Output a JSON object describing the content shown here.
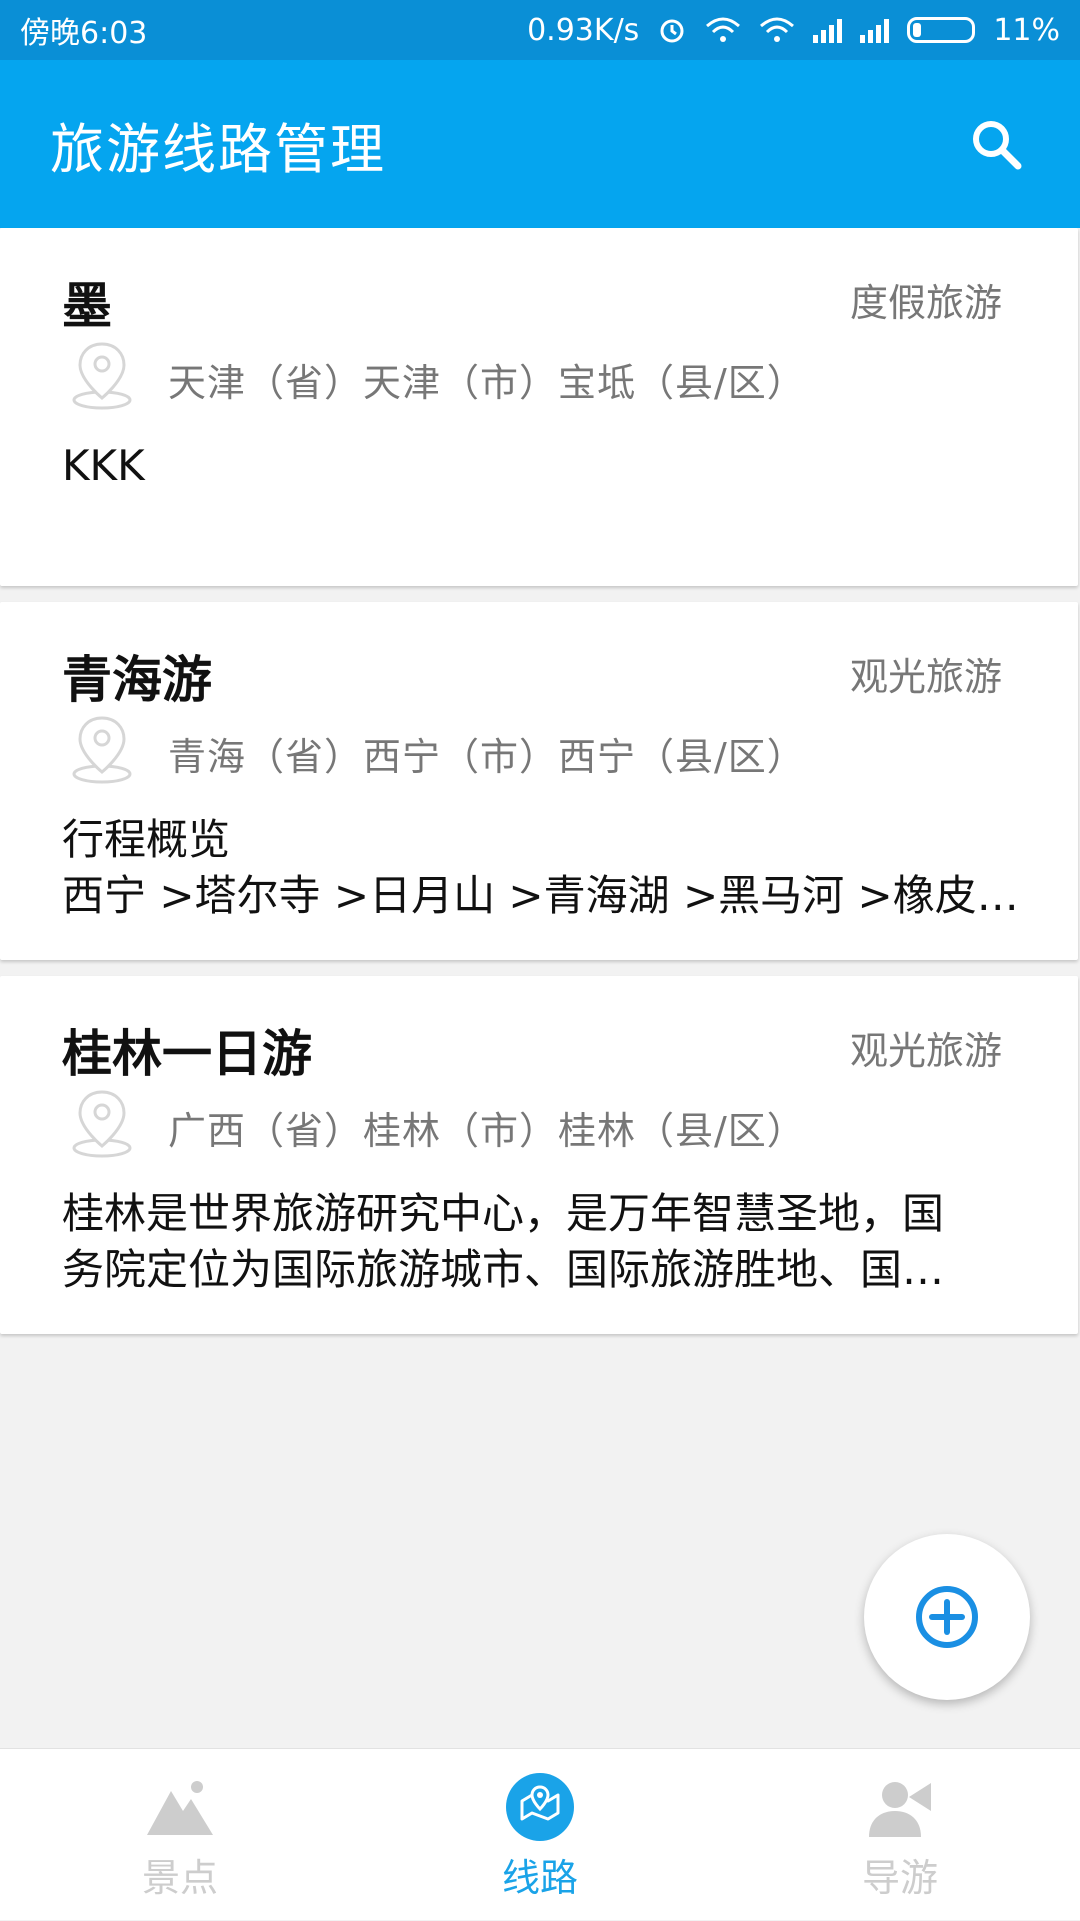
{
  "status_bar": {
    "time": "傍晚6:03",
    "network_speed": "0.93K/s",
    "battery": "11%"
  },
  "app_bar": {
    "title": "旅游线路管理",
    "search_icon": "search-icon"
  },
  "routes": [
    {
      "title": "墨",
      "type": "度假旅游",
      "location": "天津（省）天津（市）宝坻（县/区）",
      "description": [
        "KKK"
      ]
    },
    {
      "title": "青海游",
      "type": "观光旅游",
      "location": "青海（省）西宁（市）西宁（县/区）",
      "description": [
        "行程概览",
        "西宁 >塔尔寺 >日月山 >青海湖 >黑马河 >橡皮…"
      ]
    },
    {
      "title": "桂林一日游",
      "type": "观光旅游",
      "location": "广西（省）桂林（市）桂林（县/区）",
      "description": [
        "桂林是世界旅游研究中心，是万年智慧圣地，国",
        "务院定位为国际旅游城市、国际旅游胜地、国…"
      ]
    }
  ],
  "fab": {
    "icon": "add-circle-icon"
  },
  "bottom_nav": {
    "items": [
      {
        "label": "景点",
        "icon": "mountain-icon",
        "active": false
      },
      {
        "label": "线路",
        "icon": "map-route-icon",
        "active": true
      },
      {
        "label": "导游",
        "icon": "guide-icon",
        "active": false
      }
    ]
  },
  "colors": {
    "primary": "#05a5ef",
    "status_bar": "#0a8fd6",
    "active_tab": "#1aa3e8",
    "inactive_tab": "#cdcdcd"
  }
}
